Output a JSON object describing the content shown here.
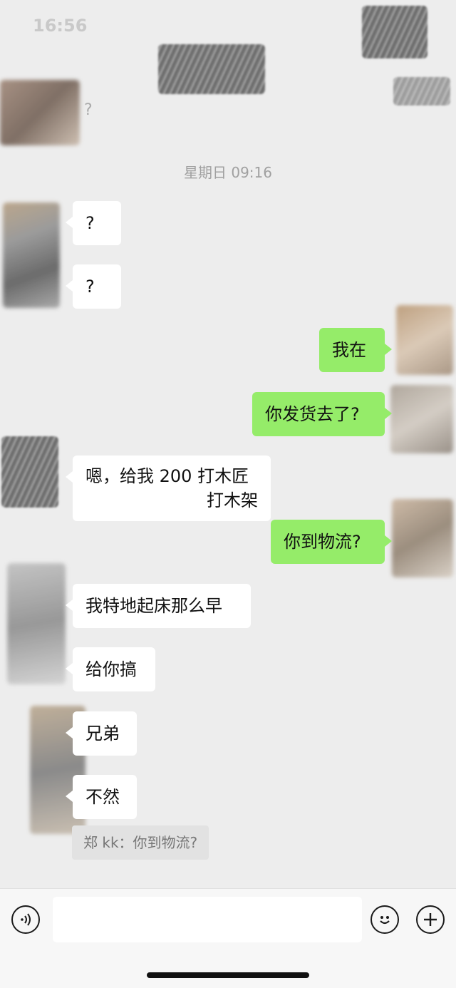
{
  "status_bar": {
    "time": "16:56"
  },
  "header": {
    "subtitle_mark": "?"
  },
  "timestamp": "星期日 09:16",
  "messages": [
    {
      "side": "in",
      "text": "?"
    },
    {
      "side": "in",
      "text": "?"
    },
    {
      "side": "out",
      "text": "我在"
    },
    {
      "side": "out",
      "text": "你发货去了?"
    },
    {
      "side": "in",
      "line1": "嗯，给我 200 打木匠",
      "line2": "打木架"
    },
    {
      "side": "out",
      "text": "你到物流?"
    },
    {
      "side": "in",
      "text": "我特地起床那么早"
    },
    {
      "side": "in",
      "text": "给你搞"
    },
    {
      "side": "in",
      "text": "兄弟"
    },
    {
      "side": "in",
      "text": "不然"
    }
  ],
  "quote": "郑 kk：你到物流?",
  "input_bar": {
    "voice_icon": "voice-icon",
    "emoji_icon": "emoji-icon",
    "plus_icon": "plus-icon",
    "input_value": ""
  },
  "colors": {
    "outgoing_bubble": "#95ec69",
    "incoming_bubble": "#ffffff",
    "background": "#ededed"
  }
}
